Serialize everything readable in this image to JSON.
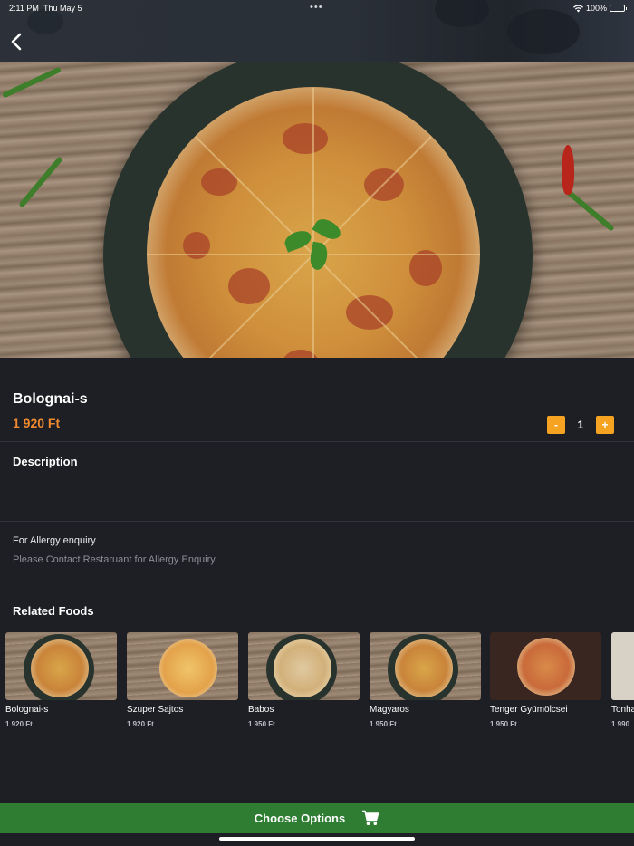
{
  "status_bar": {
    "time": "2:11 PM",
    "date": "Thu May 5",
    "battery": "100%",
    "dots": "•••"
  },
  "header": {
    "back_icon": "chevron-left-icon"
  },
  "product": {
    "name": "Bolognai-s",
    "price": "1 920 Ft",
    "quantity": "1",
    "minus_label": "-",
    "plus_label": "+"
  },
  "description": {
    "title": "Description",
    "text": ""
  },
  "allergy": {
    "label": "For Allergy enquiry",
    "text": "Please Contact Restaruant for Allergy Enquiry"
  },
  "related": {
    "title": "Related Foods",
    "items": [
      {
        "name": "Bolognai-s",
        "price": "1 920 Ft"
      },
      {
        "name": "Szuper Sajtos",
        "price": "1 920 Ft"
      },
      {
        "name": "Babos",
        "price": "1 950 Ft"
      },
      {
        "name": "Magyaros",
        "price": "1 950 Ft"
      },
      {
        "name": "Tenger Gyümölcsei",
        "price": "1 950 Ft"
      },
      {
        "name": "Tonha",
        "price": "1 990"
      }
    ]
  },
  "footer": {
    "choose_label": "Choose Options",
    "cart_icon": "cart-icon"
  },
  "colors": {
    "background": "#1e1f25",
    "accent_price": "#f08a30",
    "qty_button": "#f6a321",
    "choose_button": "#2e7d32"
  }
}
